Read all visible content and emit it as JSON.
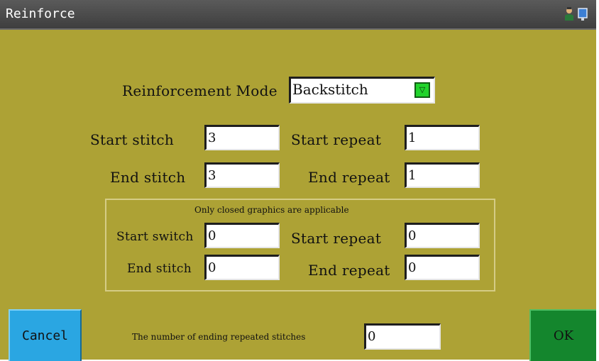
{
  "window": {
    "title": "Reinforce"
  },
  "mode": {
    "label": "Reinforcement Mode",
    "value": "Backstitch"
  },
  "fields": {
    "start_stitch": {
      "label": "Start stitch",
      "value": "3"
    },
    "start_repeat": {
      "label": "Start repeat",
      "value": "1"
    },
    "end_stitch": {
      "label": "End stitch",
      "value": "3"
    },
    "end_repeat": {
      "label": "End repeat",
      "value": "1"
    }
  },
  "closed_group": {
    "caption": "Only closed graphics are applicable",
    "start_switch": {
      "label": "Start switch",
      "value": "0"
    },
    "start_repeat": {
      "label": "Start repeat",
      "value": "0"
    },
    "end_stitch": {
      "label": "End stitch",
      "value": "0"
    },
    "end_repeat": {
      "label": "End repeat",
      "value": "0"
    }
  },
  "ending_repeated": {
    "label": "The number of ending repeated stitches",
    "value": "0"
  },
  "buttons": {
    "cancel": "Cancel",
    "ok": "OK"
  },
  "icons": {
    "dropdown": "▽",
    "user": "user-icon",
    "screen": "screen-icon"
  }
}
